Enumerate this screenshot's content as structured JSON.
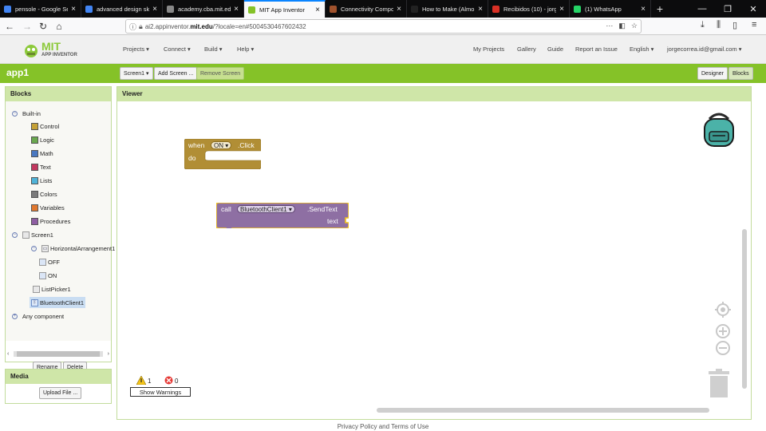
{
  "browser": {
    "tabs": [
      {
        "label": "pensole - Google Se",
        "favicon_color": "#4285f4",
        "active": false
      },
      {
        "label": "advanced design sk",
        "favicon_color": "#4285f4",
        "active": false
      },
      {
        "label": "academy.cba.mit.edu/cl",
        "favicon_color": "#888888",
        "active": false
      },
      {
        "label": "MIT App Inventor",
        "favicon_color": "#85c228",
        "active": true
      },
      {
        "label": "Connectivity Compo",
        "favicon_color": "#a0522d",
        "active": false
      },
      {
        "label": "How to Make (Almo",
        "favicon_color": "#222222",
        "active": false
      },
      {
        "label": "Recibidos (10) - jorg",
        "favicon_color": "#d93025",
        "active": false
      },
      {
        "label": "(1) WhatsApp",
        "favicon_color": "#25d366",
        "active": false
      }
    ],
    "url_prefix": "ai2.appinventor.",
    "url_host": "mit.edu",
    "url_suffix": "/?locale=en#5004530467602432"
  },
  "appinventor": {
    "logo_mit": "MIT",
    "logo_sub": "APP INVENTOR",
    "menus": [
      "Projects ▾",
      "Connect ▾",
      "Build ▾",
      "Help ▾"
    ],
    "right_links": [
      "My Projects",
      "Gallery",
      "Guide",
      "Report an Issue",
      "English ▾",
      "jorgecorrea.id@gmail.com ▾"
    ]
  },
  "project": {
    "name": "app1",
    "screen_select": "Screen1 ▾",
    "add_screen": "Add Screen ...",
    "remove_screen": "Remove Screen",
    "designer": "Designer",
    "blocks": "Blocks"
  },
  "blocks_panel": {
    "title": "Blocks",
    "builtin_label": "Built-in",
    "builtin": [
      {
        "label": "Control",
        "color": "#c5a136"
      },
      {
        "label": "Logic",
        "color": "#6aa84f"
      },
      {
        "label": "Math",
        "color": "#4a78c0"
      },
      {
        "label": "Text",
        "color": "#c2385e"
      },
      {
        "label": "Lists",
        "color": "#4fb3d8"
      },
      {
        "label": "Colors",
        "color": "#7b7b7b"
      },
      {
        "label": "Variables",
        "color": "#e0782e"
      },
      {
        "label": "Procedures",
        "color": "#8e5ea2"
      }
    ],
    "screen": "Screen1",
    "arrangement": "HorizontalArrangement1",
    "btn_off": "OFF",
    "btn_on": "ON",
    "listpicker": "ListPicker1",
    "bluetooth": "BluetoothClient1",
    "any_component": "Any component",
    "rename": "Rename",
    "delete": "Delete"
  },
  "media": {
    "title": "Media",
    "upload": "Upload File ..."
  },
  "viewer": {
    "title": "Viewer",
    "event_block": {
      "when": "when",
      "component": "ON ▾",
      "event": ".Click",
      "do": "do"
    },
    "call_block": {
      "call": "call",
      "component": "BluetoothClient1 ▾",
      "method": ".SendText",
      "arg": "text"
    },
    "warnings_count": "1",
    "errors_count": "0",
    "show_warnings": "Show Warnings"
  },
  "footer": "Privacy Policy and Terms of Use"
}
